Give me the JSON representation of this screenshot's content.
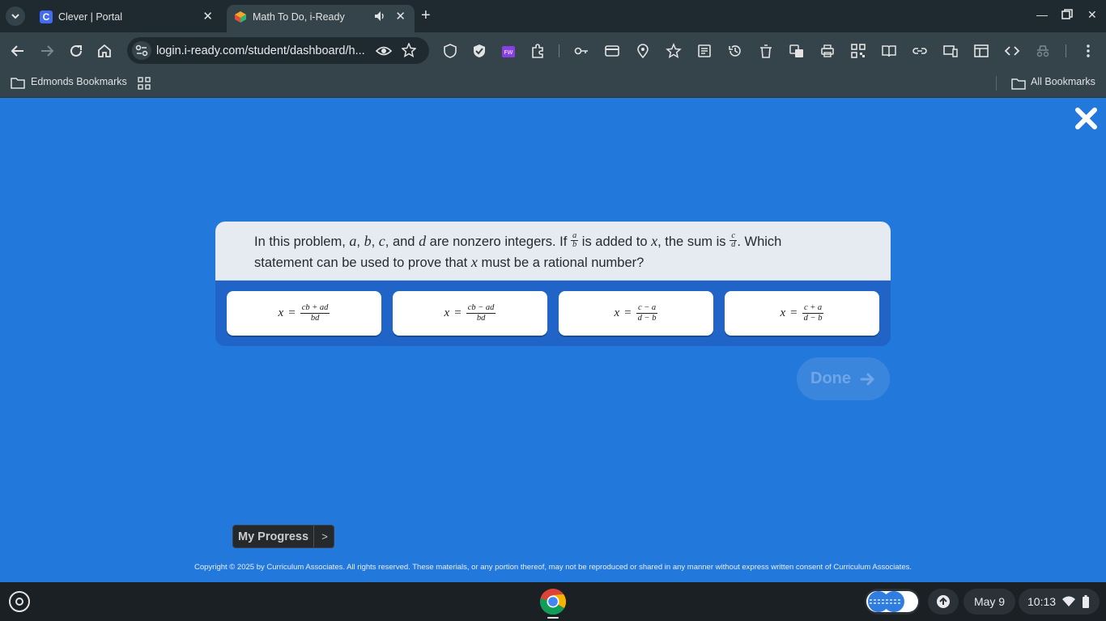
{
  "browser": {
    "tabs": [
      {
        "title": "Clever | Portal",
        "favicon": "clever-favicon",
        "active": false
      },
      {
        "title": "Math To Do, i-Ready",
        "favicon": "iready-favicon",
        "active": true,
        "audio": true
      }
    ],
    "address_bar": {
      "url": "login.i-ready.com/student/dashboard/h..."
    },
    "bookmarks": {
      "folder": "Edmonds Bookmarks",
      "all_bookmarks": "All Bookmarks"
    }
  },
  "question": {
    "stem": {
      "part1": "In this problem,",
      "var_a": "a",
      "comma1": ",",
      "var_b": "b",
      "comma2": ",",
      "var_c": "c",
      "comma3": ", and",
      "var_d": "d",
      "part2": "are nonzero integers. If",
      "frac1_num": "a",
      "frac1_den": "b",
      "part3": "is added to",
      "var_x1": "x",
      "part4": ", the sum is",
      "frac2_num": "c",
      "frac2_den": "d",
      "part5": ". Which statement can be used to prove that",
      "var_x2": "x",
      "part6": "must be a rational number?"
    },
    "choices": [
      {
        "lhs": "x",
        "eq": "=",
        "num": "cb + ad",
        "den": "bd"
      },
      {
        "lhs": "x",
        "eq": "=",
        "num": "cb − ad",
        "den": "bd"
      },
      {
        "lhs": "x",
        "eq": "=",
        "num": "c − a",
        "den": "d − b"
      },
      {
        "lhs": "x",
        "eq": "=",
        "num": "c + a",
        "den": "d − b"
      }
    ],
    "done_label": "Done"
  },
  "footer": {
    "progress_label": "My Progress",
    "progress_arrow": ">",
    "copyright": "Copyright © 2025 by Curriculum Associates. All rights reserved. These materials, or any portion thereof, may not be reproduced or shared in any manner without express written consent of Curriculum Associates."
  },
  "shelf": {
    "date": "May 9",
    "time": "10:13"
  },
  "colors": {
    "page_bg": "#2378db",
    "card_bg": "#1f64c6",
    "stem_bg": "#e6ebf2",
    "done_disabled": "#3b86dd"
  }
}
